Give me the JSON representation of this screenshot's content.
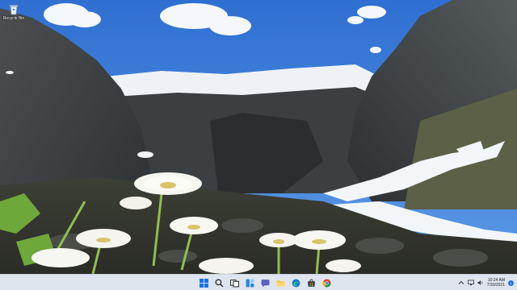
{
  "desktop": {
    "icons": [
      {
        "label": "Recycle Bin",
        "icon": "recycle-bin-icon"
      }
    ]
  },
  "taskbar": {
    "apps": [
      {
        "name": "start",
        "icon": "windows-logo-icon"
      },
      {
        "name": "search",
        "icon": "search-icon"
      },
      {
        "name": "task-view",
        "icon": "task-view-icon"
      },
      {
        "name": "widgets",
        "icon": "widgets-icon"
      },
      {
        "name": "chat",
        "icon": "chat-icon"
      },
      {
        "name": "file-explorer",
        "icon": "folder-icon"
      },
      {
        "name": "edge",
        "icon": "edge-browser-icon"
      },
      {
        "name": "store",
        "icon": "store-icon"
      },
      {
        "name": "chrome",
        "icon": "chrome-icon"
      }
    ],
    "tray": {
      "icons": [
        "chevron-up-icon",
        "network-icon",
        "volume-icon"
      ],
      "time": "10:24 AM",
      "date": "7/30/2021",
      "notification_count": "1"
    }
  },
  "colors": {
    "taskbar_bg": "#dfe5ef",
    "accent": "#1a73e8"
  }
}
